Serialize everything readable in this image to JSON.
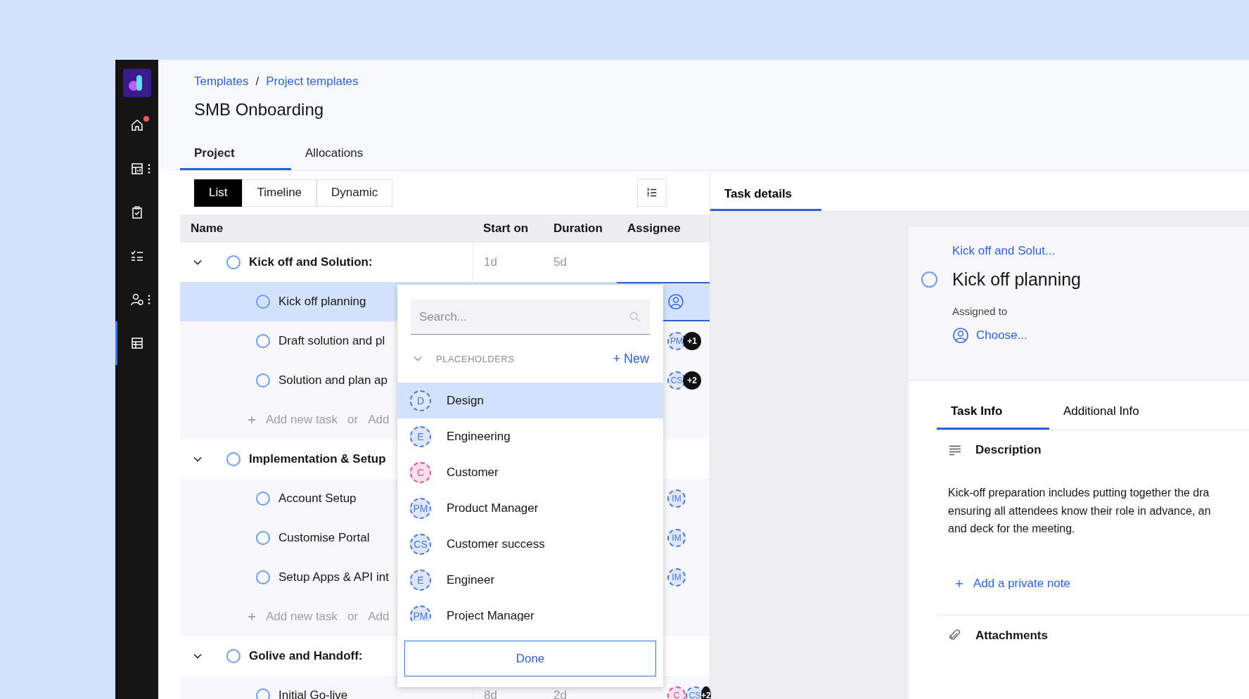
{
  "sidebar": {
    "items": [
      {
        "kind": "logo",
        "selected": false,
        "notification": false,
        "menu": false
      },
      {
        "kind": "home",
        "selected": false,
        "notification": true,
        "menu": false
      },
      {
        "kind": "dashboard",
        "selected": false,
        "notification": false,
        "menu": true
      },
      {
        "kind": "clipboard",
        "selected": false,
        "notification": false,
        "menu": false
      },
      {
        "kind": "checklist",
        "selected": false,
        "notification": false,
        "menu": false
      },
      {
        "kind": "people",
        "selected": false,
        "notification": false,
        "menu": true
      },
      {
        "kind": "table",
        "selected": true,
        "notification": false,
        "menu": false
      }
    ]
  },
  "breadcrumb": [
    "Templates",
    "Project templates"
  ],
  "breadcrumb_separator": "/",
  "title": "SMB Onboarding",
  "tabs": [
    {
      "label": "Project",
      "selected": true
    },
    {
      "label": "Allocations",
      "selected": false
    }
  ],
  "views": [
    {
      "label": "List",
      "selected": true
    },
    {
      "label": "Timeline",
      "selected": false
    },
    {
      "label": "Dynamic",
      "selected": false
    }
  ],
  "table": {
    "columns": [
      "Name",
      "Start on",
      "Duration",
      "Assignee"
    ],
    "groups": [
      {
        "name": "Kick off and Solution:",
        "start": "1d",
        "duration": "5d",
        "expanded": true,
        "tasks": [
          {
            "name": "Kick off planning",
            "selected": true,
            "assignees": [
              {
                "kind": "empty"
              }
            ]
          },
          {
            "name": "Draft solution and pl",
            "selected": false,
            "assignees": [
              {
                "kind": "placeholder",
                "text": "PM",
                "color": "#4a78d8"
              },
              {
                "kind": "count",
                "text": "+1"
              }
            ]
          },
          {
            "name": "Solution and plan ap",
            "selected": false,
            "assignees": [
              {
                "kind": "placeholder",
                "text": "CS",
                "color": "#4a78d8"
              },
              {
                "kind": "count",
                "text": "+2"
              }
            ]
          }
        ],
        "add_row": {
          "add_task": "Add new task",
          "or": "or",
          "add_other": "Add"
        }
      },
      {
        "name": "Implementation & Setup",
        "expanded": true,
        "tasks": [
          {
            "name": "Account Setup",
            "selected": false,
            "assignees": [
              {
                "kind": "placeholder",
                "text": "IM",
                "color": "#4a78d8"
              }
            ]
          },
          {
            "name": "Customise Portal",
            "selected": false,
            "assignees": [
              {
                "kind": "placeholder",
                "text": "IM",
                "color": "#4a78d8"
              }
            ]
          },
          {
            "name": "Setup Apps & API int",
            "selected": false,
            "assignees": [
              {
                "kind": "placeholder",
                "text": "IM",
                "color": "#4a78d8"
              }
            ]
          }
        ],
        "add_row": {
          "add_task": "Add new task",
          "or": "or",
          "add_other": "Add"
        }
      },
      {
        "name": "Golive and Handoff:",
        "expanded": true,
        "tasks": [
          {
            "name": "Initial Go-live",
            "start": "8d",
            "duration": "2d",
            "selected": false,
            "assignees": [
              {
                "kind": "placeholder",
                "text": "C",
                "color": "#e0508a"
              },
              {
                "kind": "placeholder",
                "text": "CS",
                "color": "#4a78d8"
              },
              {
                "kind": "count",
                "text": "+2"
              }
            ]
          }
        ]
      }
    ]
  },
  "assignee_dropdown": {
    "search_placeholder": "Search...",
    "section": "PLACEHOLDERS",
    "section_expanded": true,
    "new_button": "+ New",
    "options": [
      {
        "initials": "D",
        "label": "Design",
        "color": "#4a78d8",
        "selected": true
      },
      {
        "initials": "E",
        "label": "Engineering",
        "color": "#4a78d8",
        "selected": false
      },
      {
        "initials": "C",
        "label": "Customer",
        "color": "#e0508a",
        "selected": false
      },
      {
        "initials": "PM",
        "label": "Product Manager",
        "color": "#4a78d8",
        "selected": false
      },
      {
        "initials": "CS",
        "label": "Customer success",
        "color": "#4a78d8",
        "selected": false
      },
      {
        "initials": "E",
        "label": "Engineer",
        "color": "#4a78d8",
        "selected": false
      },
      {
        "initials": "PM",
        "label": "Project Manager",
        "color": "#4a78d8",
        "selected": false
      }
    ],
    "done_button": "Done"
  },
  "details": {
    "tabs": [
      {
        "label": "Task details",
        "selected": true
      }
    ],
    "parent_link": "Kick off and Solut...",
    "task_title": "Kick off planning",
    "assigned_label": "Assigned to",
    "assign_link": "Choose...",
    "info_tabs": [
      {
        "label": "Task Info",
        "selected": true
      },
      {
        "label": "Additional Info",
        "selected": false
      }
    ],
    "description_heading": "Description",
    "description_lines": [
      "Kick-off preparation includes putting together the dra",
      "ensuring all attendees know their role in advance, an",
      "and deck for the meeting."
    ],
    "add_note": "Add a private note",
    "attachments_heading": "Attachments"
  }
}
